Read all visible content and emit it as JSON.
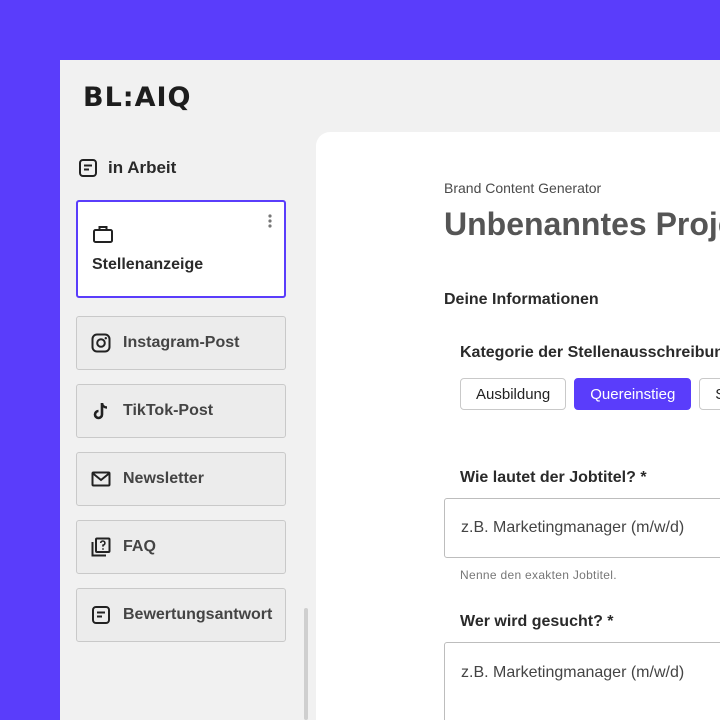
{
  "logo": "BL:AIQ",
  "sidebar": {
    "status_label": "in Arbeit",
    "items": [
      {
        "label": "Stellenanzeige",
        "icon": "briefcase-icon"
      },
      {
        "label": "Instagram-Post",
        "icon": "instagram-icon"
      },
      {
        "label": "TikTok-Post",
        "icon": "tiktok-icon"
      },
      {
        "label": "Newsletter",
        "icon": "mail-icon"
      },
      {
        "label": "FAQ",
        "icon": "question-pages-icon"
      },
      {
        "label": "Bewertungsantwort",
        "icon": "note-icon"
      }
    ]
  },
  "main": {
    "breadcrumb": "Brand Content Generator",
    "title": "Unbenanntes Projekt",
    "section_title": "Deine Informationen",
    "category_label": "Kategorie der Stellenausschreibung",
    "chips": [
      "Ausbildung",
      "Quereinstieg",
      "S"
    ],
    "selected_chip": "Quereinstieg",
    "jobtitle_label": "Wie lautet der Jobtitel? *",
    "jobtitle_placeholder": "z.B. Marketingmanager (m/w/d)",
    "jobtitle_hint": "Nenne den exakten Jobtitel.",
    "wanted_label": "Wer wird gesucht? *",
    "wanted_placeholder": "z.B. Marketingmanager (m/w/d)"
  },
  "colors": {
    "accent": "#5a3dfb",
    "panel": "#f1f1f1",
    "card_bg": "#ffffff"
  }
}
